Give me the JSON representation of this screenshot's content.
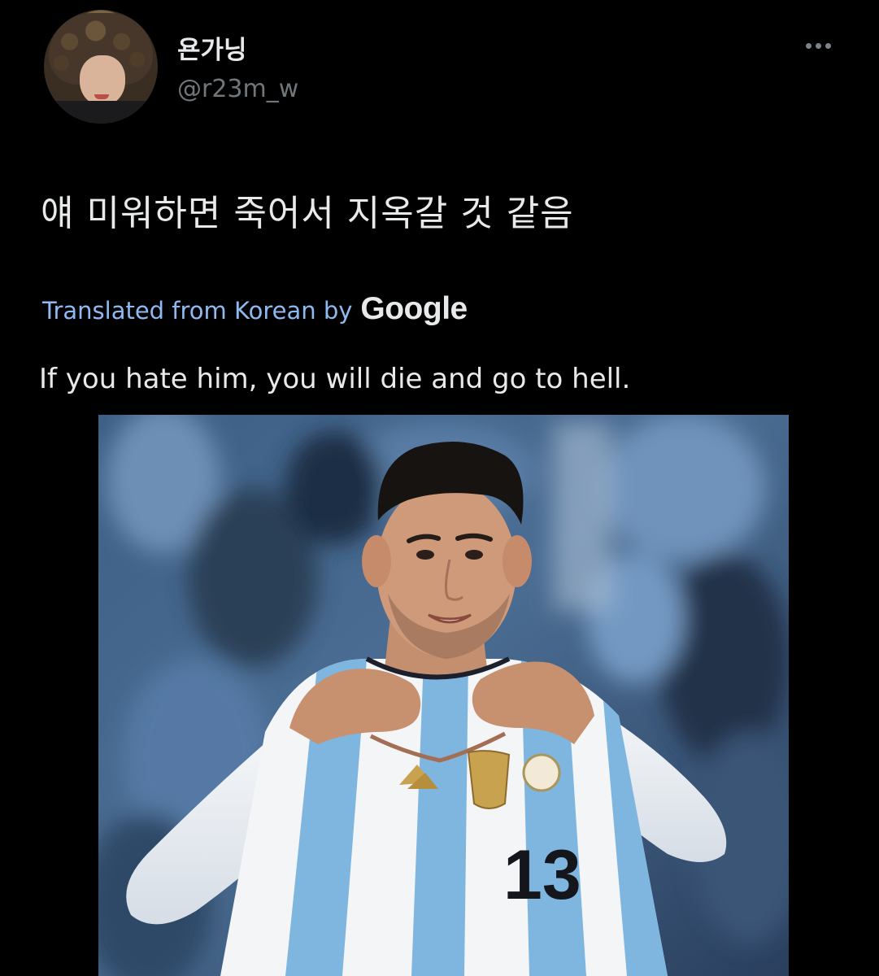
{
  "tweet": {
    "author": {
      "display_name": "욘가닝",
      "handle": "@r23m_w",
      "avatar_icon": "user-avatar"
    },
    "text": "얘 미워하면 죽어서 지옥갈 것 같음",
    "translation_label": "Translated from Korean by",
    "translation_provider": "Google",
    "translated_text": "If you hate him, you will die and go to hell.",
    "more_icon": "more-horizontal-icon",
    "media": {
      "jersey_number": "13"
    }
  },
  "colors": {
    "background": "#000000",
    "primary_text": "#e7e9ea",
    "secondary_text": "#71767b",
    "translation_link": "#8ebaf1"
  }
}
